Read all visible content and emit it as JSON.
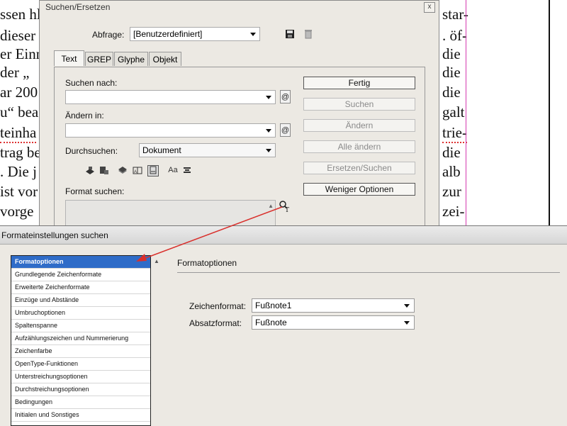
{
  "document": {
    "left_lines": [
      "ssen hl",
      "dieser",
      "er Einn",
      " der  „",
      "ar 200",
      "u“ bea",
      "teinha",
      "trag be",
      ". Die j",
      "ist vor",
      "  vorge"
    ],
    "right_lines": [
      "star-",
      ". öf-",
      "die",
      "die",
      "die",
      "galt",
      "trie-",
      "die",
      "alb",
      "zur",
      "zei-"
    ]
  },
  "find_dialog": {
    "title": "Suchen/Ersetzen",
    "close_label": "x",
    "query_label": "Abfrage:",
    "query_value": "[Benutzerdefiniert]",
    "tabs": [
      "Text",
      "GREP",
      "Glyphe",
      "Objekt"
    ],
    "search_for_label": "Suchen nach:",
    "change_to_label": "Ändern in:",
    "search_in_label": "Durchsuchen:",
    "search_in_value": "Dokument",
    "format_search_label": "Format suchen:",
    "buttons": {
      "done": "Fertig",
      "find": "Suchen",
      "change": "Ändern",
      "change_all": "Alle ändern",
      "change_find": "Ersetzen/Suchen",
      "fewer_options": "Weniger Optionen"
    },
    "icons": [
      "save-query-icon",
      "delete-query-icon",
      "special-char-icon",
      "format-search-icon"
    ],
    "tool_icons": [
      "locked-layers-icon",
      "locked-stories-icon",
      "hidden-layers-icon",
      "master-pages-icon",
      "footnotes-icon",
      "case-sensitive-icon",
      "whole-word-icon"
    ],
    "case_label": "Aa"
  },
  "format_dialog": {
    "title": "Formateinstellungen suchen",
    "list_items": [
      "Formatoptionen",
      "Grundlegende Zeichenformate",
      "Erweiterte Zeichenformate",
      "Einzüge und Abstände",
      "Umbruchoptionen",
      "Spaltenspanne",
      "Aufzählungszeichen und Nummerierung",
      "Zeichenfarbe",
      "OpenType-Funktionen",
      "Unterstreichungsoptionen",
      "Durchstreichungsoptionen",
      "Bedingungen",
      "Initialen und Sonstiges"
    ],
    "selected_item": "Formatoptionen",
    "section_title": "Formatoptionen",
    "char_format_label": "Zeichenformat:",
    "char_format_value": "Fußnote1",
    "para_format_label": "Absatzformat:",
    "para_format_value": "Fußnote"
  },
  "colors": {
    "selection": "#2f6cc8",
    "annotation_arrow": "#d9302c",
    "margin_guide": "#d43bb0"
  }
}
